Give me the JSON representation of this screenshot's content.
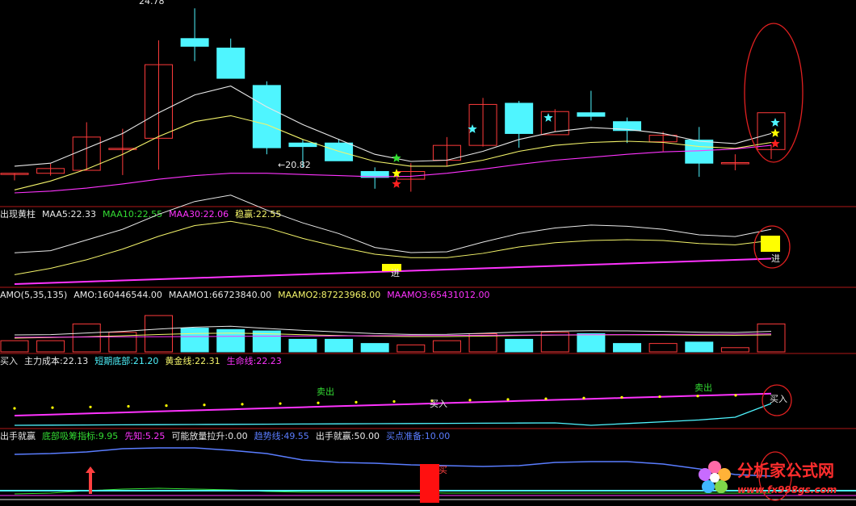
{
  "colors": {
    "up": "#ff3b3b",
    "down": "#4ff5ff",
    "white": "#e8e8e8",
    "yellow": "#f4f46a",
    "magenta": "#ff33ff",
    "green": "#33dd33",
    "blue": "#5a7dff",
    "red_marker": "#ff1010",
    "signal_yellow": "#ffff00",
    "divider": "#b01818"
  },
  "panel1": {
    "high_label": "24.78",
    "low_label": "←20.82"
  },
  "panel2": {
    "title": "出现黄柱",
    "items": [
      {
        "key": "MAA5",
        "value": "MAA5:22.33",
        "color": "#e8e8e8"
      },
      {
        "key": "MAA10",
        "value": "MAA10:22.55",
        "color": "#33dd33"
      },
      {
        "key": "MAA30",
        "value": "MAA30:22.06",
        "color": "#ff33ff"
      },
      {
        "key": "stable",
        "value": "稳赢:22.55",
        "color": "#f4f46a"
      }
    ],
    "signal_label": "进"
  },
  "panel3": {
    "title": "AMO(5,35,135)",
    "items": [
      {
        "key": "AMO",
        "value": "AMO:160446544.00",
        "color": "#e8e8e8"
      },
      {
        "key": "MAAMO1",
        "value": "MAAMO1:66723840.00",
        "color": "#e8e8e8"
      },
      {
        "key": "MAAMO2",
        "value": "MAAMO2:87223968.00",
        "color": "#f4f46a"
      },
      {
        "key": "MAAMO3",
        "value": "MAAMO3:65431012.00",
        "color": "#ff33ff"
      }
    ]
  },
  "panel4": {
    "title": "买入",
    "items": [
      {
        "key": "cost",
        "value": "主力成本:22.13",
        "color": "#e8e8e8"
      },
      {
        "key": "bottom",
        "value": "短期底部:21.20",
        "color": "#4ff5ff"
      },
      {
        "key": "gold",
        "value": "黄金线:22.31",
        "color": "#f4f46a"
      },
      {
        "key": "life",
        "value": "生命线:22.23",
        "color": "#ff33ff"
      }
    ],
    "sell_label_1": "卖出",
    "sell_label_2": "卖出",
    "buy_label_1": "买入",
    "buy_label_2": "买入"
  },
  "panel5": {
    "title": "出手就赢",
    "items": [
      {
        "key": "absorb",
        "value": "底部吸筹指标:9.95",
        "color": "#33dd33"
      },
      {
        "key": "foresee",
        "value": "先知:5.25",
        "color": "#ff33ff"
      },
      {
        "key": "volume",
        "value": "可能放量拉升:0.00",
        "color": "#e8e8e8"
      },
      {
        "key": "trend",
        "value": "趋势线:49.55",
        "color": "#5a7dff"
      },
      {
        "key": "win",
        "value": "出手就赢:50.00",
        "color": "#e8e8e8"
      },
      {
        "key": "ready",
        "value": "买点准备:10.00",
        "color": "#5a7dff"
      }
    ],
    "buy_marker": "买"
  },
  "watermark": {
    "name": "分析家公式网",
    "url": "www.fx998gs.com"
  },
  "chart_data": {
    "type": "candlestick",
    "candles": [
      {
        "o": 21.88,
        "h": 21.88,
        "l": 21.76,
        "c": 21.88
      },
      {
        "o": 21.88,
        "h": 22.04,
        "l": 21.84,
        "c": 21.96
      },
      {
        "o": 21.93,
        "h": 22.74,
        "l": 21.93,
        "c": 22.49
      },
      {
        "o": 22.3,
        "h": 22.63,
        "l": 21.85,
        "c": 22.3
      },
      {
        "o": 22.47,
        "h": 24.12,
        "l": 21.94,
        "c": 23.71
      },
      {
        "o": 24.15,
        "h": 24.66,
        "l": 23.77,
        "c": 24.02
      },
      {
        "o": 23.99,
        "h": 24.15,
        "l": 23.55,
        "c": 23.48
      },
      {
        "o": 23.36,
        "h": 23.43,
        "l": 22.2,
        "c": 22.31
      },
      {
        "o": 22.39,
        "h": 22.44,
        "l": 21.98,
        "c": 22.33
      },
      {
        "o": 22.39,
        "h": 22.46,
        "l": 22.19,
        "c": 22.09
      },
      {
        "o": 21.91,
        "h": 21.98,
        "l": 21.62,
        "c": 21.81
      },
      {
        "o": 21.78,
        "h": 22.05,
        "l": 21.57,
        "c": 21.91
      },
      {
        "o": 22.1,
        "h": 22.49,
        "l": 21.99,
        "c": 22.35
      },
      {
        "o": 22.35,
        "h": 23.15,
        "l": 22.33,
        "c": 23.04
      },
      {
        "o": 23.06,
        "h": 23.1,
        "l": 22.31,
        "c": 22.55
      },
      {
        "o": 22.53,
        "h": 22.96,
        "l": 22.58,
        "c": 22.92
      },
      {
        "o": 22.9,
        "h": 23.27,
        "l": 22.77,
        "c": 22.84
      },
      {
        "o": 22.75,
        "h": 22.82,
        "l": 22.39,
        "c": 22.6
      },
      {
        "o": 22.41,
        "h": 22.58,
        "l": 22.25,
        "c": 22.52
      },
      {
        "o": 22.44,
        "h": 22.66,
        "l": 21.82,
        "c": 22.05
      },
      {
        "o": 22.06,
        "h": 22.2,
        "l": 21.93,
        "c": 22.06
      },
      {
        "o": 22.28,
        "h": 22.36,
        "l": 22.12,
        "c": 22.9
      }
    ],
    "ma_white": [
      22.0,
      22.05,
      22.3,
      22.55,
      22.9,
      23.2,
      23.35,
      23.0,
      22.7,
      22.45,
      22.2,
      22.08,
      22.1,
      22.25,
      22.45,
      22.58,
      22.65,
      22.62,
      22.55,
      22.42,
      22.38,
      22.55
    ],
    "ma_yellow": [
      21.6,
      21.75,
      21.95,
      22.2,
      22.5,
      22.75,
      22.85,
      22.7,
      22.45,
      22.25,
      22.08,
      22.0,
      22.0,
      22.1,
      22.25,
      22.35,
      22.4,
      22.42,
      22.4,
      22.33,
      22.3,
      22.4
    ],
    "ma_magenta": [
      21.55,
      21.58,
      21.63,
      21.7,
      21.78,
      21.84,
      21.88,
      21.88,
      21.86,
      21.84,
      21.82,
      21.83,
      21.88,
      21.95,
      22.03,
      22.1,
      22.15,
      22.2,
      22.24,
      22.26,
      22.29,
      22.35
    ],
    "amo_volumes": [
      0.4,
      0.4,
      1.0,
      0.7,
      1.3,
      0.85,
      0.8,
      0.75,
      0.45,
      0.45,
      0.3,
      0.25,
      0.4,
      0.65,
      0.45,
      0.7,
      0.65,
      0.3,
      0.3,
      0.35,
      0.15,
      1.0
    ],
    "buy_dots_count": 20
  }
}
